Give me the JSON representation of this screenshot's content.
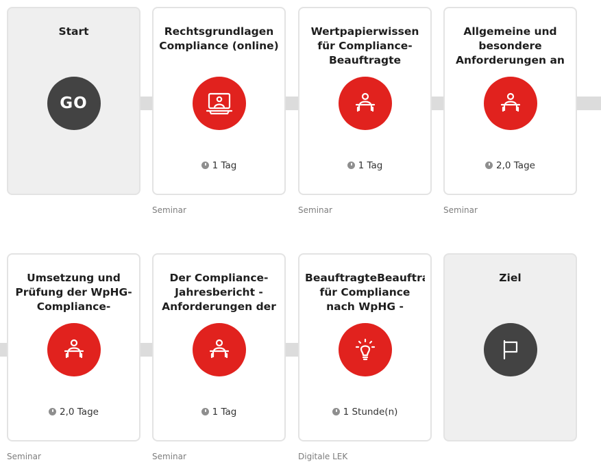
{
  "row1": {
    "start": {
      "title": "Start",
      "badge": "GO"
    },
    "steps": [
      {
        "title": "Rechtsgrundlagen Compliance (online)",
        "duration": "1 Tag",
        "type": "Seminar",
        "icon": "online-training-icon"
      },
      {
        "title": "Wertpapierwissen für Compliance-Beauftragte",
        "duration": "1 Tag",
        "type": "Seminar",
        "icon": "classroom-icon"
      },
      {
        "title": "Allgemeine und besondere Anforderungen an",
        "duration": "2,0 Tage",
        "type": "Seminar",
        "icon": "classroom-icon"
      }
    ]
  },
  "row2": {
    "steps": [
      {
        "title": "Umsetzung und Prüfung der WpHG-Compliance-",
        "duration": "2,0 Tage",
        "type": "Seminar",
        "icon": "classroom-icon"
      },
      {
        "title": "Der Compliance-Jahresbericht - Anforderungen der",
        "duration": "1 Tag",
        "type": "Seminar",
        "icon": "classroom-icon"
      },
      {
        "title": "BeauftragteBeauftragter für Compliance nach WpHG -",
        "duration": "1 Stunde(n)",
        "type": "Digitale LEK",
        "icon": "lightbulb-icon"
      }
    ],
    "goal": {
      "title": "Ziel",
      "icon": "flag-icon"
    }
  },
  "colors": {
    "accent": "#e1221e",
    "dark": "#434343",
    "track": "#dcdcdc",
    "card_border": "#e3e3e3",
    "endpoint_bg": "#efefef"
  }
}
